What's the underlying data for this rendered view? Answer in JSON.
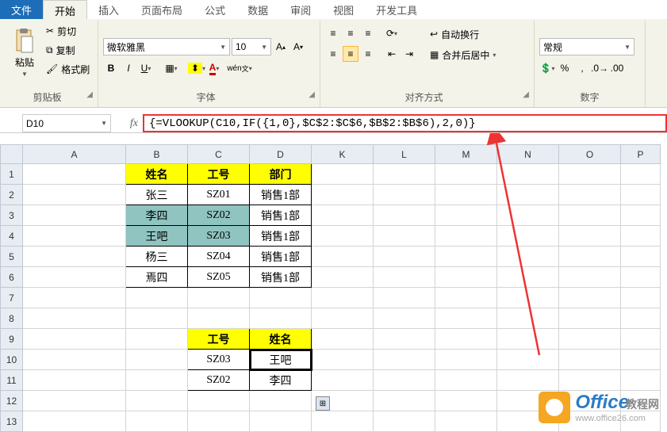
{
  "tabs": {
    "file": "文件",
    "home": "开始",
    "insert": "插入",
    "layout": "页面布局",
    "formula": "公式",
    "data": "数据",
    "review": "审阅",
    "view": "视图",
    "dev": "开发工具"
  },
  "ribbon": {
    "paste": "粘贴",
    "cut": "剪切",
    "copy": "复制",
    "painter": "格式刷",
    "font_name": "微软雅黑",
    "font_size": "10",
    "wrap": "自动换行",
    "merge": "合并后居中",
    "numfmt": "常规",
    "group_clipboard": "剪贴板",
    "group_font": "字体",
    "group_align": "对齐方式",
    "group_number": "数字"
  },
  "namebox": "D10",
  "formula": "{=VLOOKUP(C10,IF({1,0},$C$2:$C$6,$B$2:$B$6),2,0)}",
  "columns": [
    "A",
    "B",
    "C",
    "D",
    "K",
    "L",
    "M",
    "N",
    "O",
    "P"
  ],
  "rows": [
    "1",
    "2",
    "3",
    "4",
    "5",
    "6",
    "7",
    "8",
    "9",
    "10",
    "11",
    "12",
    "13"
  ],
  "table1": {
    "h1": "姓名",
    "h2": "工号",
    "h3": "部门",
    "rows": [
      [
        "张三",
        "SZ01",
        "销售1部"
      ],
      [
        "李四",
        "SZ02",
        "销售1部"
      ],
      [
        "王吧",
        "SZ03",
        "销售1部"
      ],
      [
        "杨三",
        "SZ04",
        "销售1部"
      ],
      [
        "焉四",
        "SZ05",
        "销售1部"
      ]
    ]
  },
  "table2": {
    "h1": "工号",
    "h2": "姓名",
    "rows": [
      [
        "SZ03",
        "王吧"
      ],
      [
        "SZ02",
        "李四"
      ]
    ]
  },
  "logo_text": "Office",
  "logo_sub": "教程网",
  "logo_url": "www.office26.com"
}
